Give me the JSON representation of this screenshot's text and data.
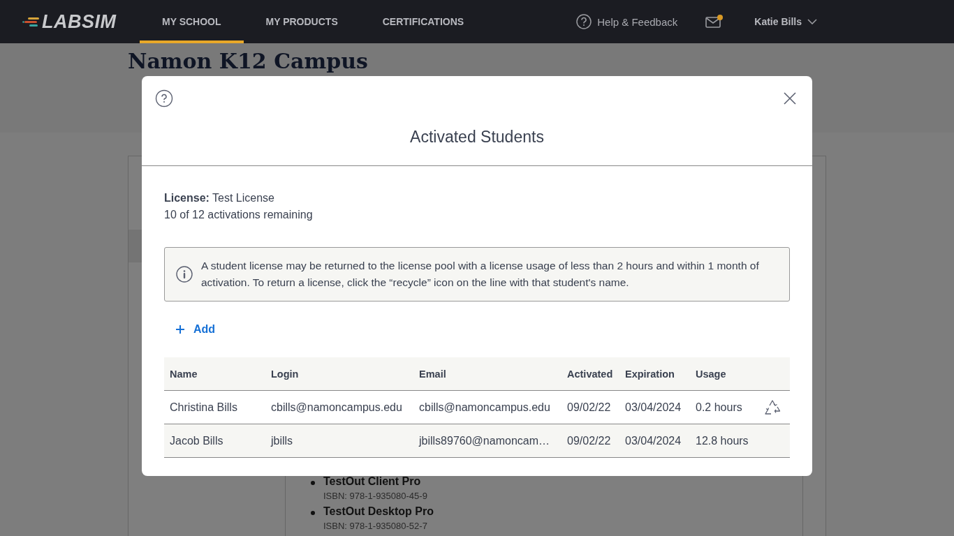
{
  "navbar": {
    "logo": "LABSIM",
    "tabs": [
      {
        "label": "MY SCHOOL",
        "selected": true
      },
      {
        "label": "MY PRODUCTS",
        "selected": false
      },
      {
        "label": "CERTIFICATIONS",
        "selected": false
      }
    ],
    "help": "Help & Feedback",
    "mail": {
      "unread": true
    },
    "user": "Katie Bills"
  },
  "page": {
    "title": "Namon K12 Campus",
    "products": [
      {
        "name": "TestOut Client Pro",
        "isbn": "ISBN: 978-1-935080-45-9"
      },
      {
        "name": "TestOut Desktop Pro",
        "isbn": "ISBN: 978-1-935080-52-7"
      }
    ]
  },
  "dialog": {
    "title": "Activated Students",
    "license_label": "License:",
    "license_name": "Test License",
    "remaining": "10 of 12 activations remaining",
    "info": "A student license may be returned to the license pool with a license usage of less than 2 hours and within 1 month of activation. To return a license, click the “recycle” icon on the line with that student's name.",
    "add": "Add",
    "table": {
      "columns": [
        "Name",
        "Login",
        "Email",
        "Activated",
        "Expiration",
        "Usage"
      ],
      "rows": [
        {
          "cells": [
            "Christina Bills",
            "cbills@namoncampus.edu",
            "cbills@namoncampus.edu",
            "09/02/22",
            "03/04/2024",
            "0.2 hours"
          ],
          "returnable": true
        },
        {
          "cells": [
            "Jacob Bills",
            "jbills",
            "jbills89760@namoncam…",
            "09/02/22",
            "03/04/2024",
            "12.8 hours"
          ],
          "returnable": false
        }
      ]
    }
  }
}
